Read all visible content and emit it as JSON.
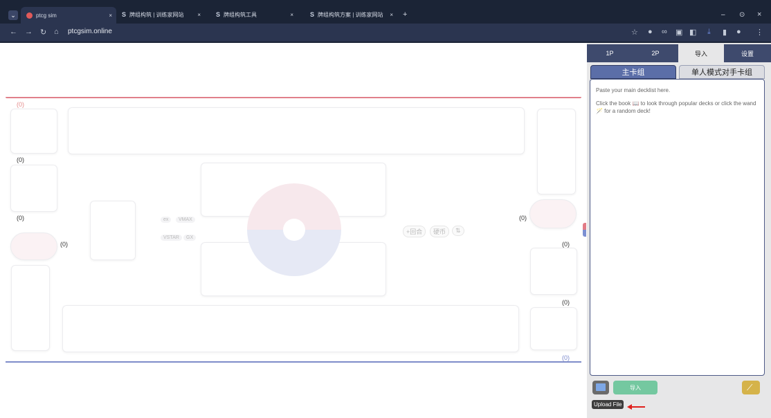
{
  "browser": {
    "tabs": [
      {
        "label": "ptcg sim",
        "close": "×"
      },
      {
        "label": "牌组构筑 | 训练家网站",
        "close": "×"
      },
      {
        "label": "牌组构筑工具",
        "close": "×"
      },
      {
        "label": "牌组构筑方案 | 训练家网站",
        "close": "×"
      }
    ],
    "new_tab": "+",
    "url": "ptcgsim.online",
    "window": {
      "minimize": "–",
      "restore": "⊙",
      "close": "×"
    }
  },
  "board": {
    "counters": {
      "top": "(0)",
      "left1": "(0)",
      "left2": "(0)",
      "left3": "(0)",
      "right1": "(0)",
      "right2": "(0)",
      "right3": "(0)",
      "bottom": "(0)"
    },
    "markers": {
      "vmax": "VMAX",
      "ex": "ex",
      "vstar": "VSTAR",
      "gx": "GX"
    },
    "controls": {
      "turn": "+回合",
      "coin": "硬币",
      "swap": "⇅"
    }
  },
  "sidebar": {
    "tabs": [
      "1P",
      "2P",
      "导入",
      "设置"
    ],
    "active_tab": "导入",
    "deck_tabs": [
      "主卡组",
      "单人模式对手卡组"
    ],
    "placeholder_line1": "Paste your main decklist here.",
    "placeholder_line2": "Click the book 📖 to look through popular decks or click the wand 🪄 for a random deck!",
    "import_button": "导入",
    "upload_label": "Upload File"
  },
  "colors": {
    "accent_blue": "#4d5a86",
    "tab_active": "#5b6ea8",
    "import_green": "#74c8a0",
    "wand_gold": "#d5b34a"
  }
}
